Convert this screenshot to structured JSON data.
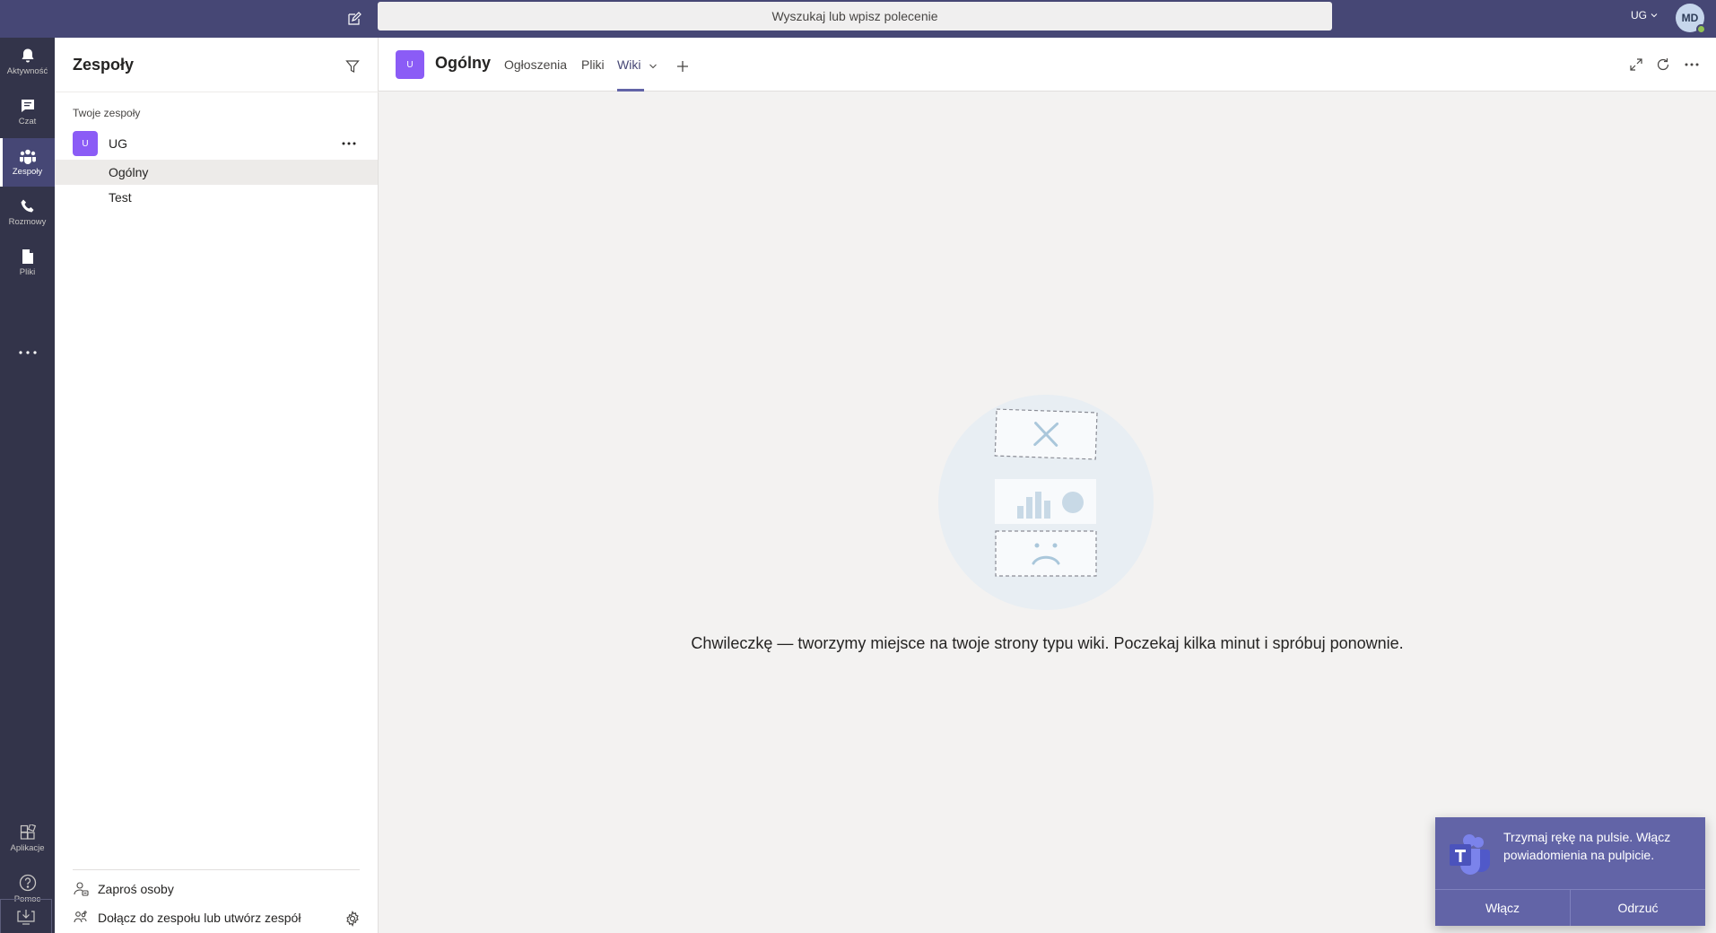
{
  "topbar": {
    "search_placeholder": "Wyszukaj lub wpisz polecenie",
    "tenant": "UG",
    "avatar_initials": "MD"
  },
  "rail": {
    "items": [
      {
        "label": "Aktywność",
        "icon": "bell-icon"
      },
      {
        "label": "Czat",
        "icon": "chat-icon"
      },
      {
        "label": "Zespoły",
        "icon": "teams-icon"
      },
      {
        "label": "Rozmowy",
        "icon": "phone-icon"
      },
      {
        "label": "Pliki",
        "icon": "file-icon"
      }
    ],
    "bottom": [
      {
        "label": "Aplikacje",
        "icon": "apps-icon"
      },
      {
        "label": "Pomoc",
        "icon": "help-icon"
      }
    ]
  },
  "panel": {
    "title": "Zespoły",
    "section_label": "Twoje zespoły",
    "team": {
      "avatar": "U",
      "name": "UG"
    },
    "channels": [
      "Ogólny",
      "Test"
    ],
    "footer": {
      "invite": "Zaproś osoby",
      "join": "Dołącz do zespołu lub utwórz zespół"
    }
  },
  "main": {
    "channel_avatar": "U",
    "channel_title": "Ogólny",
    "tabs": [
      "Ogłoszenia",
      "Pliki",
      "Wiki"
    ],
    "active_tab": "Wiki",
    "empty_message": "Chwileczkę — tworzymy miejsce na twoje strony typu wiki. Poczekaj kilka minut i spróbuj ponownie."
  },
  "toast": {
    "message": "Trzymaj rękę na pulsie. Włącz powiadomienia na pulpicie.",
    "accept": "Włącz",
    "dismiss": "Odrzuć"
  },
  "colors": {
    "topbar": "#464775",
    "rail": "#33344a",
    "accent": "#6264a7",
    "team_avatar": "#8b5cf6"
  }
}
